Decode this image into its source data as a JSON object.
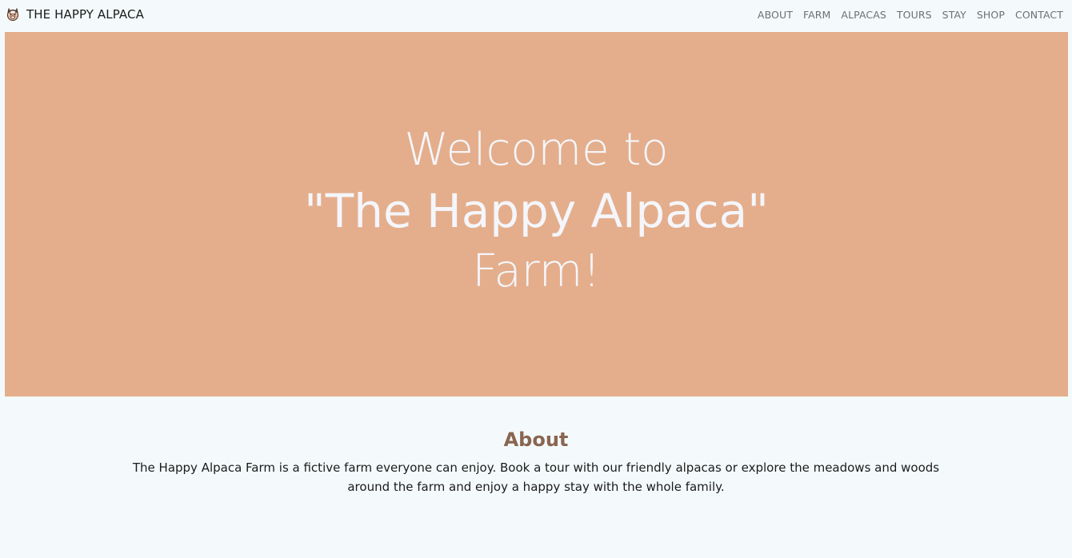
{
  "nav": {
    "brand": "THE HAPPY ALPACA",
    "brand_icon": "alpaca-face-icon",
    "links": [
      "ABOUT",
      "FARM",
      "ALPACAS",
      "TOURS",
      "STAY",
      "SHOP",
      "CONTACT"
    ]
  },
  "hero": {
    "line1": "Welcome to",
    "line2": "\"The Happy Alpaca\"",
    "line3": "Farm!",
    "background_color": "#e4ae8c"
  },
  "about": {
    "title": "About",
    "text": "The Happy Alpaca Farm is a fictive farm everyone can enjoy. Book a tour with our friendly alpacas or explore the meadows and woods around the farm and enjoy a happy stay with the whole family."
  },
  "colors": {
    "page_background": "#f4fafc",
    "accent": "#8a6550"
  }
}
